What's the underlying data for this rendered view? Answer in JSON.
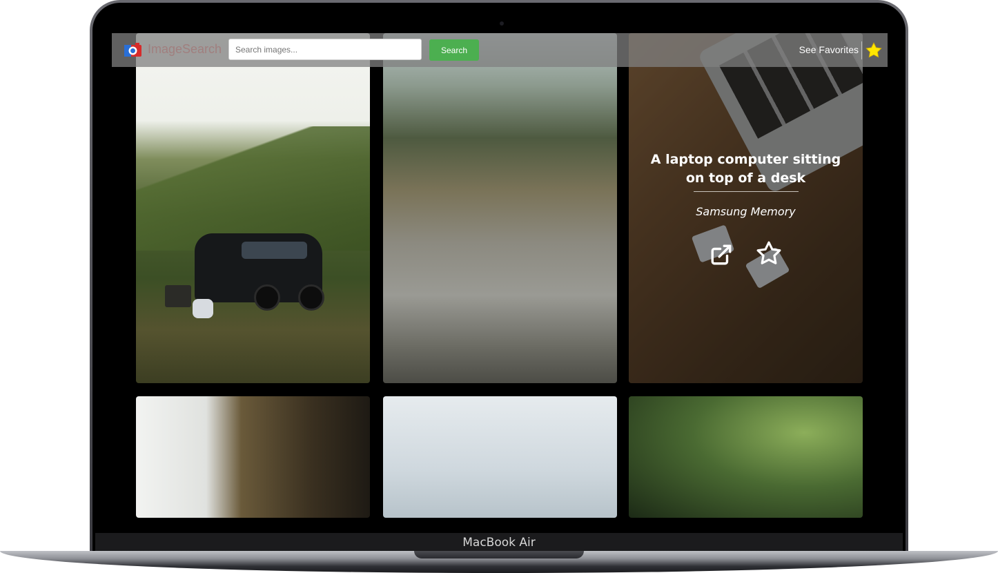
{
  "device": {
    "label": "MacBook Air"
  },
  "navbar": {
    "brand": "ImageSearch",
    "search": {
      "placeholder": "Search images...",
      "value": ""
    },
    "search_button": "Search",
    "favorites_link": "See Favorites",
    "colors": {
      "search_button_bg": "#4caf50",
      "star": "#ffe600"
    }
  },
  "gallery": {
    "hover_card": {
      "title": "A laptop computer sitting on top of a desk",
      "author": "Samsung Memory",
      "icons": [
        "external-link-icon",
        "star-outline-icon"
      ]
    }
  }
}
